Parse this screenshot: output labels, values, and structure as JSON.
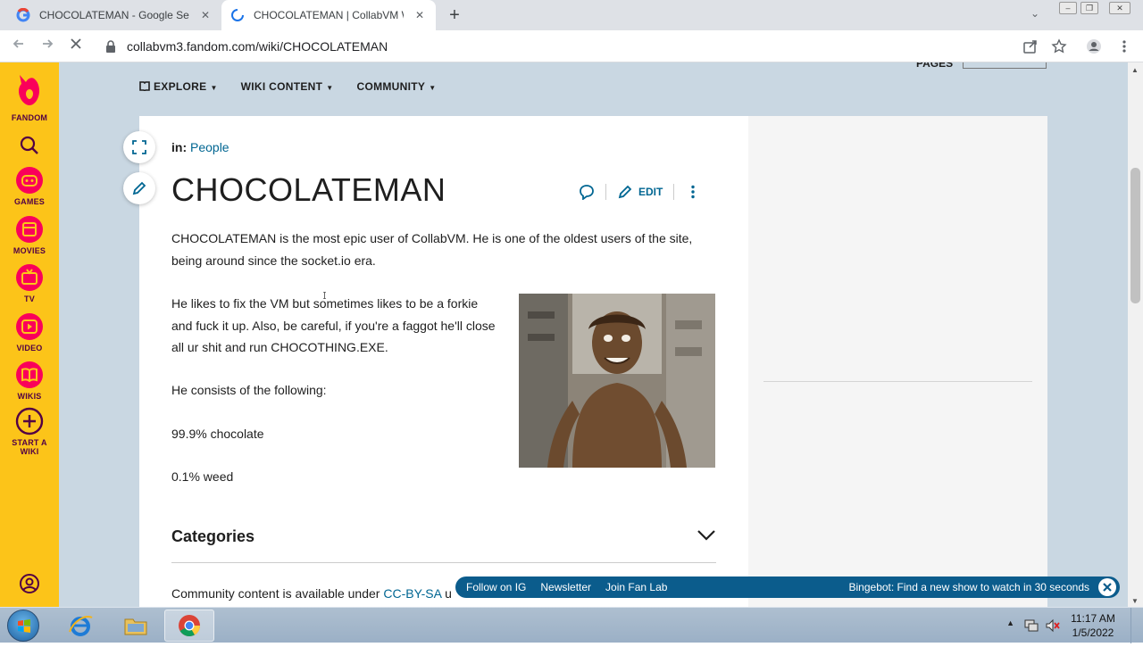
{
  "browser": {
    "tabs": [
      {
        "title": "CHOCOLATEMAN - Google Search",
        "close": "✕"
      },
      {
        "title": "CHOCOLATEMAN | CollabVM Wiki",
        "close": "✕"
      }
    ],
    "new_tab": "+",
    "tab_search": "⌄",
    "url": "collabvm3.fandom.com/wiki/CHOCOLATEMAN"
  },
  "rail": {
    "logo_label": "FANDOM",
    "items": [
      {
        "label": "GAMES",
        "icon": "gamepad-icon"
      },
      {
        "label": "MOVIES",
        "icon": "film-icon"
      },
      {
        "label": "TV",
        "icon": "tv-icon"
      },
      {
        "label": "VIDEO",
        "icon": "play-icon"
      },
      {
        "label": "WIKIS",
        "icon": "book-icon"
      },
      {
        "label": "START A",
        "label2": "WIKI",
        "icon": "plus-circle-icon"
      }
    ]
  },
  "wiki_nav": {
    "explore": "EXPLORE",
    "wiki_content": "WIKI CONTENT",
    "community": "COMMUNITY",
    "pages": "PAGES"
  },
  "article": {
    "in_label": "in:",
    "category_link": "People",
    "title": "CHOCOLATEMAN",
    "edit_label": "EDIT",
    "paragraph1": "CHOCOLATEMAN is the most epic user of CollabVM. He is one of the oldest users of the site, being around since the socket.io era.",
    "paragraph2": "He likes to fix the VM but sometimes likes to be a forkie and fuck it up. Also, be careful, if you're a faggot he'll close all ur shit and run CHOCOTHING.EXE.",
    "paragraph3": "He consists of the following:",
    "item1": "99.9% chocolate",
    "item2": "0.1% weed",
    "categories_label": "Categories",
    "license_prefix": "Community content is available under ",
    "license_link": "CC-BY-SA",
    "license_suffix": " u"
  },
  "fan_bar": {
    "follow": "Follow on IG",
    "newsletter": "Newsletter",
    "fanlab": "Join Fan Lab",
    "promo": "Bingebot: Find a new show to watch in 30 seconds"
  },
  "taskbar": {
    "time": "11:17 AM",
    "date": "1/5/2022"
  },
  "colors": {
    "rail": "#fcc419",
    "link": "#006692",
    "fan_bar": "#0b5c8c",
    "page_bg": "#c9d7e2"
  }
}
